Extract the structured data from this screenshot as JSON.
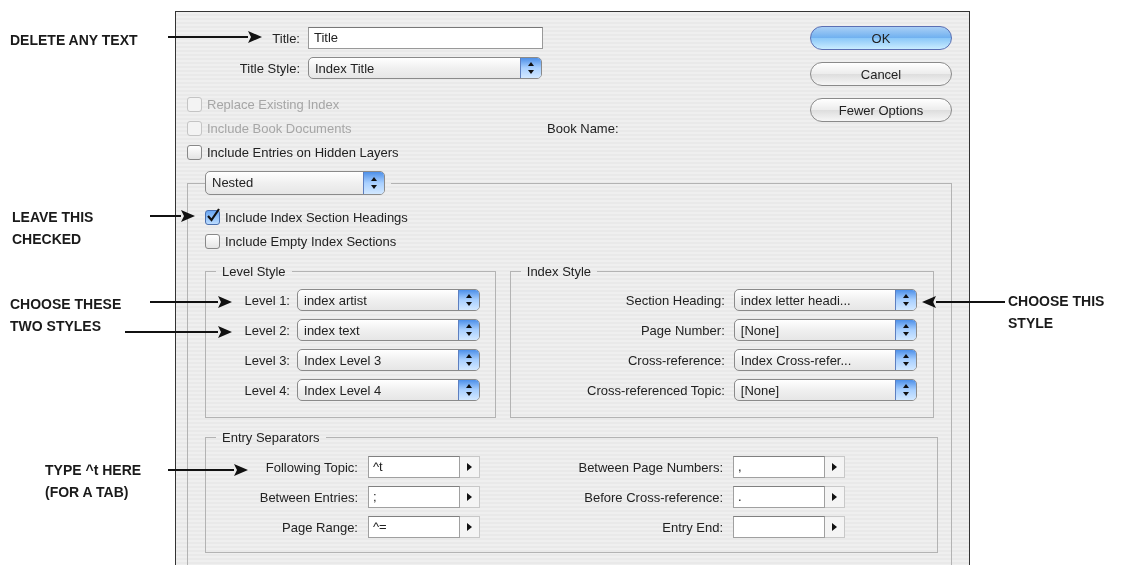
{
  "annotations": [
    {
      "lines": [
        "DELETE ANY TEXT"
      ]
    },
    {
      "lines": [
        "LEAVE THIS",
        "CHECKED"
      ]
    },
    {
      "lines": [
        "CHOOSE THESE",
        "TWO STYLES"
      ]
    },
    {
      "lines": [
        "CHOOSE THIS",
        "STYLE"
      ]
    },
    {
      "lines": [
        "TYPE ^t HERE",
        "(FOR A TAB)"
      ]
    }
  ],
  "dialog": {
    "title_field": {
      "label": "Title:",
      "value": "Title"
    },
    "title_style": {
      "label": "Title Style:",
      "value": "Index Title"
    },
    "options": [
      {
        "label": "Replace Existing Index",
        "checked": false,
        "disabled": true
      },
      {
        "label": "Include Book Documents",
        "checked": false,
        "disabled": true
      },
      {
        "label": "Include Entries on Hidden Layers",
        "checked": false,
        "disabled": false
      }
    ],
    "book_name_label": "Book Name:",
    "buttons": [
      {
        "label": "OK",
        "default": true
      },
      {
        "label": "Cancel",
        "default": false
      },
      {
        "label": "Fewer Options",
        "default": false
      }
    ],
    "format": "Nested",
    "format_options": [
      {
        "label": "Include Index Section Headings",
        "checked": true
      },
      {
        "label": "Include Empty Index Sections",
        "checked": false
      }
    ],
    "level_style": {
      "title": "Level Style",
      "rows": [
        {
          "label": "Level 1:",
          "value": "index artist"
        },
        {
          "label": "Level 2:",
          "value": "index text"
        },
        {
          "label": "Level 3:",
          "value": "Index Level 3"
        },
        {
          "label": "Level 4:",
          "value": "Index Level 4"
        }
      ]
    },
    "index_style": {
      "title": "Index Style",
      "rows": [
        {
          "label": "Section Heading:",
          "value": "index letter headi..."
        },
        {
          "label": "Page Number:",
          "value": "[None]"
        },
        {
          "label": "Cross-reference:",
          "value": "Index Cross-refer..."
        },
        {
          "label": "Cross-referenced Topic:",
          "value": "[None]"
        }
      ]
    },
    "entry_separators": {
      "title": "Entry Separators",
      "left": [
        {
          "label": "Following Topic:",
          "value": "^t"
        },
        {
          "label": "Between Entries:",
          "value": ";"
        },
        {
          "label": "Page Range:",
          "value": "^="
        }
      ],
      "right": [
        {
          "label": "Between Page Numbers:",
          "value": ","
        },
        {
          "label": "Before Cross-reference:",
          "value": "."
        },
        {
          "label": "Entry End:"
        }
      ]
    }
  }
}
